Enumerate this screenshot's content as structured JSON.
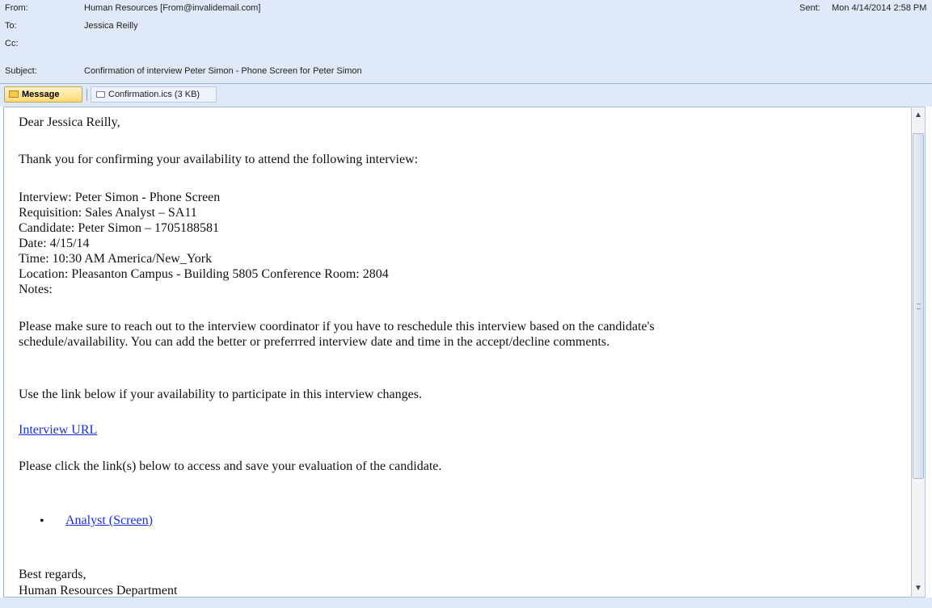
{
  "header": {
    "from_label": "From:",
    "from_value": "Human Resources [From@invalidemail.com]",
    "to_label": "To:",
    "to_value": "Jessica Reilly",
    "cc_label": "Cc:",
    "cc_value": "",
    "subject_label": "Subject:",
    "subject_value": "Confirmation of interview Peter Simon - Phone Screen for Peter Simon",
    "sent_label": "Sent:",
    "sent_value": "Mon 4/14/2014 2:58 PM"
  },
  "tabs": {
    "message_label": "Message",
    "attachment_label": "Confirmation.ics (3 KB)"
  },
  "body": {
    "greeting": "Dear Jessica Reilly,",
    "intro": "Thank you for confirming your availability to attend the following interview:",
    "details": [
      "Interview: Peter Simon - Phone Screen",
      "Requisition: Sales Analyst – SA11",
      "Candidate: Peter Simon – 1705188581",
      "Date: 4/15/14",
      "Time: 10:30 AM America/New_York",
      "Location: Pleasanton Campus - Building 5805 Conference Room: 2804",
      "Notes:"
    ],
    "reschedule_line1": "Please make sure to reach out to the interview coordinator  if you have to reschedule this interview based on the candidate's",
    "reschedule_line2": "schedule/availability. You can add the better or preferrred interview date and time in the accept/decline comments.",
    "link_intro": "Use the link below if your availability to participate in this interview changes.",
    "interview_link": "Interview URL",
    "eval_intro": "Please click the link(s) below to access and save your evaluation of the candidate.",
    "bullet": "•",
    "eval_link": "Analyst (Screen)",
    "closing": "Best regards,",
    "signature": "Human Resources Department"
  },
  "scrollbar": {
    "up_arrow": "▲",
    "down_arrow": "▼"
  },
  "icons": [
    "envelope-icon",
    "calendar-file-icon"
  ]
}
